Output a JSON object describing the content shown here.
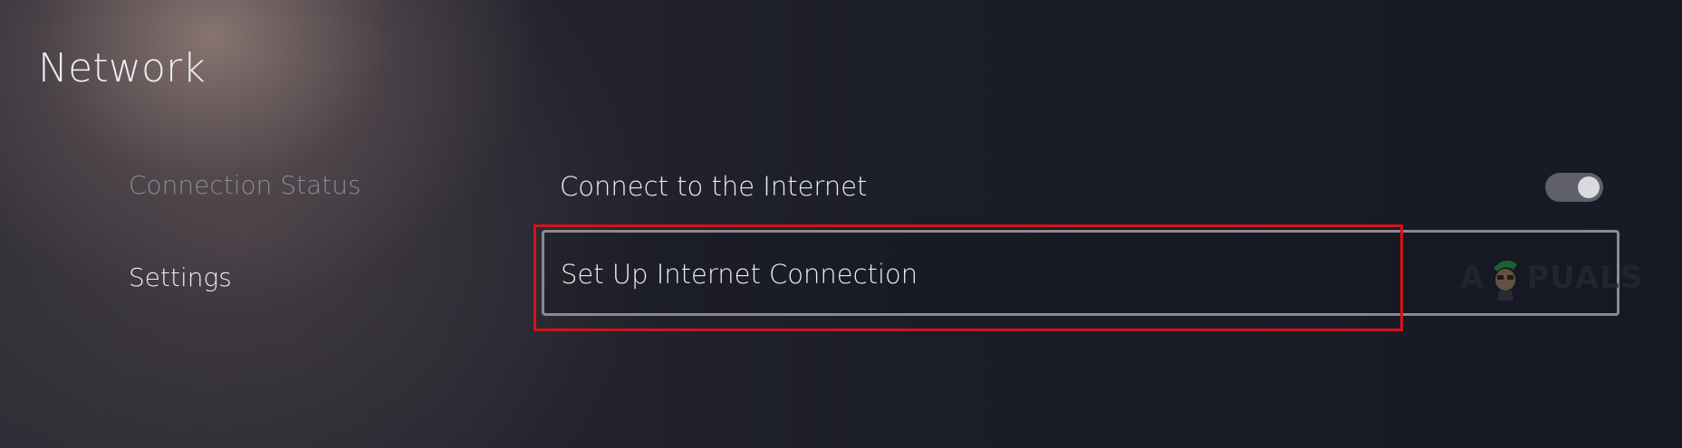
{
  "header": {
    "title": "Network"
  },
  "sidebar": {
    "items": [
      {
        "label": "Connection Status",
        "selected": false
      },
      {
        "label": "Settings",
        "selected": true
      }
    ]
  },
  "main": {
    "connect_row": {
      "label": "Connect to the Internet",
      "toggle_on": true
    },
    "setup_row": {
      "label": "Set Up Internet Connection",
      "focused": true
    }
  },
  "annotation": {
    "highlight_color": "#d2131a"
  },
  "watermark": {
    "text": "APPUALS",
    "icon": "mascot-icon"
  },
  "colors": {
    "text_primary": "#eceef2",
    "text_dim": "#8c8a92",
    "toggle_track": "#5f606b",
    "toggle_knob": "#d9dade"
  }
}
